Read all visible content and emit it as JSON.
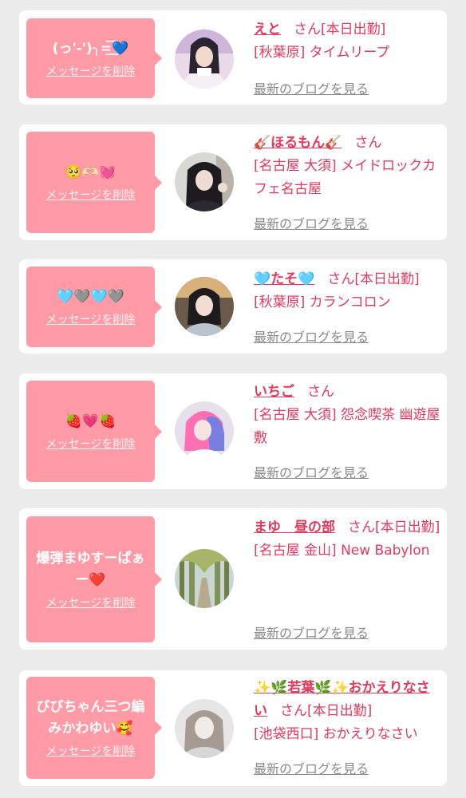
{
  "delete_label": "メッセージを削除",
  "blog_label": "最新のブログを見る",
  "honorific": "さん",
  "accent_color": "#e13a5d",
  "bubble_color": "#ff9aa6",
  "cards": [
    {
      "message": "(っ'-')╮=͟͟͞͞💙",
      "name": "えと",
      "status": "[本日出勤]",
      "shop": "[秋葉原] タイムリープ"
    },
    {
      "message": "🥺🫶🏻💓",
      "name": "🎸ほるもん🎸",
      "status": "",
      "shop": "[名古屋 大須] メイドロックカフェ名古屋"
    },
    {
      "message": "🩵🩶🩵🩶",
      "name": "🩵たそ🩵",
      "status": "[本日出勤]",
      "shop": "[秋葉原] カランコロン"
    },
    {
      "message": "🍓💗🍓",
      "name": "いちご",
      "status": "",
      "shop": "[名古屋 大須] 怨念喫茶 幽遊屋敷"
    },
    {
      "message": "爆弾まゆすーぱぁー❤️",
      "name": "まゆ　昼の部",
      "status": "[本日出勤]",
      "shop": "[名古屋 金山] New Babylon"
    },
    {
      "message": "びびちゃん三つ編みかわゆい🥰",
      "name": "✨🌿若葉🌿✨おかえりなさい",
      "status": "[本日出勤]",
      "shop": "[池袋西口] おかえりなさい"
    }
  ]
}
